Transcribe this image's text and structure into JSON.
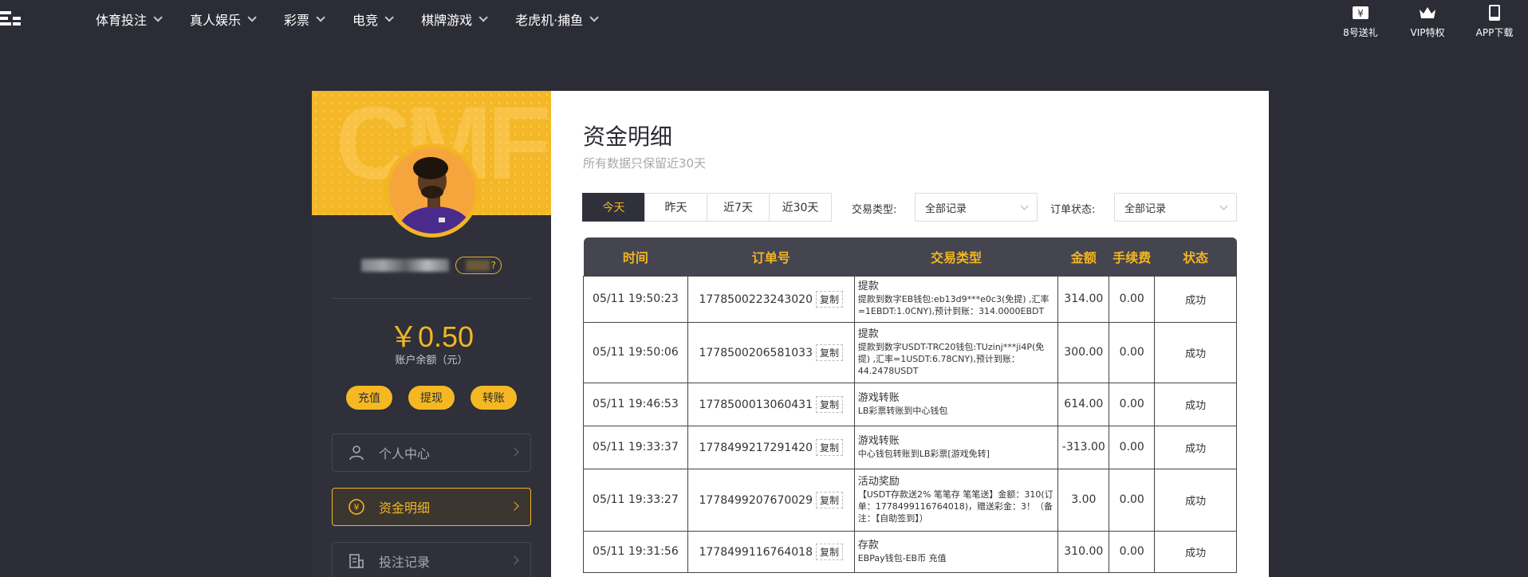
{
  "nav": {
    "items": [
      "体育投注",
      "真人娱乐",
      "彩票",
      "电竞",
      "棋牌游戏",
      "老虎机·捕鱼"
    ]
  },
  "top_right": {
    "items": [
      {
        "label": "8号送礼",
        "icon": "gift-ticket-icon"
      },
      {
        "label": "VIP特权",
        "icon": "crown-icon"
      },
      {
        "label": "APP下载",
        "icon": "phone-icon"
      }
    ]
  },
  "sidebar": {
    "watermark": "CMF",
    "balance": "￥0.50",
    "balance_label": "账户余额（元）",
    "actions": [
      "充值",
      "提现",
      "转账"
    ],
    "menu": [
      {
        "label": "个人中心",
        "icon": "user-icon",
        "active": false
      },
      {
        "label": "资金明细",
        "icon": "money-icon",
        "active": true
      },
      {
        "label": "投注记录",
        "icon": "bet-record-icon",
        "active": false
      }
    ]
  },
  "main": {
    "title": "资金明细",
    "subtitle": "所有数据只保留近30天",
    "range_tabs": [
      "今天",
      "昨天",
      "近7天",
      "近30天"
    ],
    "active_range": "今天",
    "filters": {
      "type_label": "交易类型:",
      "type_value": "全部记录",
      "status_label": "订单状态:",
      "status_value": "全部记录"
    },
    "table": {
      "headers": [
        "时间",
        "订单号",
        "交易类型",
        "金额",
        "手续费",
        "状态"
      ],
      "copy_label": "复制",
      "rows": [
        {
          "time": "05/11 19:50:23",
          "order": "1778500223243020",
          "type": "提款",
          "desc": "提款到数字EB钱包:eb13d9***e0c3(免提) ,汇率=1EBDT:1.0CNY),预计到账：314.0000EBDT",
          "amount": "314.00",
          "fee": "0.00",
          "status": "成功"
        },
        {
          "time": "05/11 19:50:06",
          "order": "1778500206581033",
          "type": "提款",
          "desc": "提款到数字USDT-TRC20钱包:TUzinj***ji4P(免提) ,汇率=1USDT:6.78CNY),预计到账：44.2478USDT",
          "amount": "300.00",
          "fee": "0.00",
          "status": "成功"
        },
        {
          "time": "05/11 19:46:53",
          "order": "1778500013060431",
          "type": "游戏转账",
          "desc": "LB彩票转账到中心钱包",
          "amount": "614.00",
          "fee": "0.00",
          "status": "成功"
        },
        {
          "time": "05/11 19:33:37",
          "order": "1778499217291420",
          "type": "游戏转账",
          "desc": "中心钱包转账到LB彩票[游戏免转]",
          "amount": "-313.00",
          "fee": "0.00",
          "status": "成功"
        },
        {
          "time": "05/11 19:33:27",
          "order": "1778499207670029",
          "type": "活动奖励",
          "desc": "【USDT存款送2% 笔笔存 笔笔送】金额：310(订单：1778499116764018)，赠送彩金：3！（备注：【自助签到】）",
          "amount": "3.00",
          "fee": "0.00",
          "status": "成功"
        },
        {
          "time": "05/11 19:31:56",
          "order": "1778499116764018",
          "type": "存款",
          "desc": "EBPay钱包-EB币 充值",
          "amount": "310.00",
          "fee": "0.00",
          "status": "成功"
        }
      ]
    }
  }
}
